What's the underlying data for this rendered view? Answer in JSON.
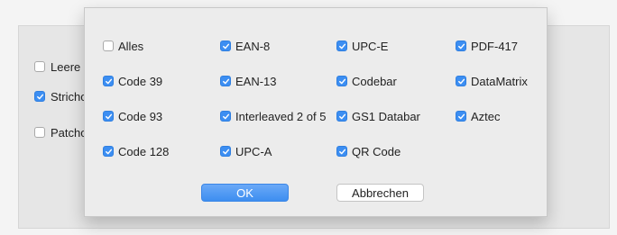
{
  "background": {
    "items": [
      {
        "label": "Leere",
        "checked": false
      },
      {
        "label": "Stricho",
        "checked": true
      },
      {
        "label": "Patcho",
        "checked": false
      }
    ]
  },
  "dialog": {
    "columns": [
      [
        {
          "label": "Alles",
          "checked": false
        },
        {
          "label": "Code 39",
          "checked": true
        },
        {
          "label": "Code 93",
          "checked": true
        },
        {
          "label": "Code 128",
          "checked": true
        }
      ],
      [
        {
          "label": "EAN-8",
          "checked": true
        },
        {
          "label": "EAN-13",
          "checked": true
        },
        {
          "label": "Interleaved 2 of 5",
          "checked": true
        },
        {
          "label": "UPC-A",
          "checked": true
        }
      ],
      [
        {
          "label": "UPC-E",
          "checked": true
        },
        {
          "label": "Codebar",
          "checked": true
        },
        {
          "label": "GS1 Databar",
          "checked": true
        },
        {
          "label": "QR Code",
          "checked": true
        }
      ],
      [
        {
          "label": "PDF-417",
          "checked": true
        },
        {
          "label": "DataMatrix",
          "checked": true
        },
        {
          "label": "Aztec",
          "checked": true
        }
      ]
    ],
    "ok_label": "OK",
    "cancel_label": "Abbrechen"
  },
  "colors": {
    "accent": "#3c8ef2",
    "dialog_bg": "#ececec",
    "window_bg": "#f4f4f4"
  },
  "icons": {
    "check": "checkmark-icon"
  }
}
